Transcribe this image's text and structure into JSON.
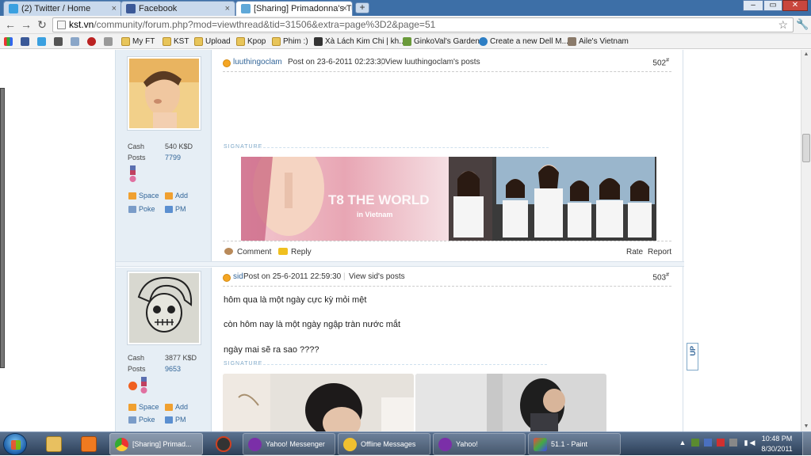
{
  "tabs": [
    {
      "label": "(2) Twitter / Home",
      "icon": "twitter-icon",
      "color": "#3aa0e0"
    },
    {
      "label": "Facebook",
      "icon": "facebook-icon",
      "color": "#3b5998"
    },
    {
      "label": "[Sharing] Primadonna's Tu...",
      "icon": "kst-icon",
      "color": "#5fa8d8"
    }
  ],
  "window": {
    "minimize": "–",
    "maximize": "▭",
    "close": "✕"
  },
  "nav": {
    "back": "←",
    "forward": "→",
    "reload": "↻"
  },
  "address": {
    "domain": "kst.vn",
    "path": "/community/forum.php?mod=viewthread&tid=31506&extra=page%3D2&page=51"
  },
  "bookmarks": [
    {
      "label": "My FT",
      "type": "folder"
    },
    {
      "label": "KST",
      "type": "folder"
    },
    {
      "label": "Upload",
      "type": "folder"
    },
    {
      "label": "Kpop",
      "type": "folder"
    },
    {
      "label": "Phim :)",
      "type": "folder"
    },
    {
      "label": "Xà Lách Kim Chi | kh...",
      "type": "link"
    },
    {
      "label": "GinkoVal's Garden",
      "type": "link"
    },
    {
      "label": "Create a new Dell M...",
      "type": "link"
    },
    {
      "label": "Aile's Vietnam",
      "type": "link"
    }
  ],
  "posts": [
    {
      "author": "luuthingoclam",
      "posted": "Post on 23-6-2011 02:23:30",
      "view_posts": "View luuthingoclam's posts",
      "number": "502",
      "sup": "#",
      "cash_label": "Cash",
      "cash_value": "540 K$D",
      "posts_label": "Posts",
      "posts_value": "7799",
      "space": "Space",
      "add": "Add",
      "poke": "Poke",
      "pm": "PM",
      "signature_label": "SIGNATURE",
      "banner_text": "T8 THE WORLD",
      "banner_sub": "in Vietnam",
      "comment": "Comment",
      "reply": "Reply",
      "rate": "Rate",
      "report": "Report"
    },
    {
      "author": "sid",
      "posted": "Post on 25-6-2011 22:59:30",
      "view_posts": "View sid's posts",
      "number": "503",
      "sup": "#",
      "cash_label": "Cash",
      "cash_value": "3877 K$D",
      "posts_label": "Posts",
      "posts_value": "9653",
      "space": "Space",
      "add": "Add",
      "poke": "Poke",
      "pm": "PM",
      "lines": [
        "hôm qua là một ngày cực kỳ mỏi mệt",
        "còn hôm nay là một ngày ngập tràn nước mắt",
        "ngày mai sẽ ra sao ????"
      ],
      "signature_label": "SIGNATURE"
    }
  ],
  "up_button": "UP",
  "taskbar": {
    "tasks": [
      {
        "label": "[Sharing] Primad...",
        "icon": "chrome-icon"
      },
      {
        "label": "Yahoo! Messenger",
        "icon": "yahoo-icon"
      },
      {
        "label": "Offline Messages",
        "icon": "messages-icon"
      },
      {
        "label": "Yahoo!",
        "icon": "yahoo-icon"
      },
      {
        "label": "51.1 - Paint",
        "icon": "paint-icon"
      }
    ],
    "time": "10:48 PM",
    "date": "8/30/2011"
  }
}
